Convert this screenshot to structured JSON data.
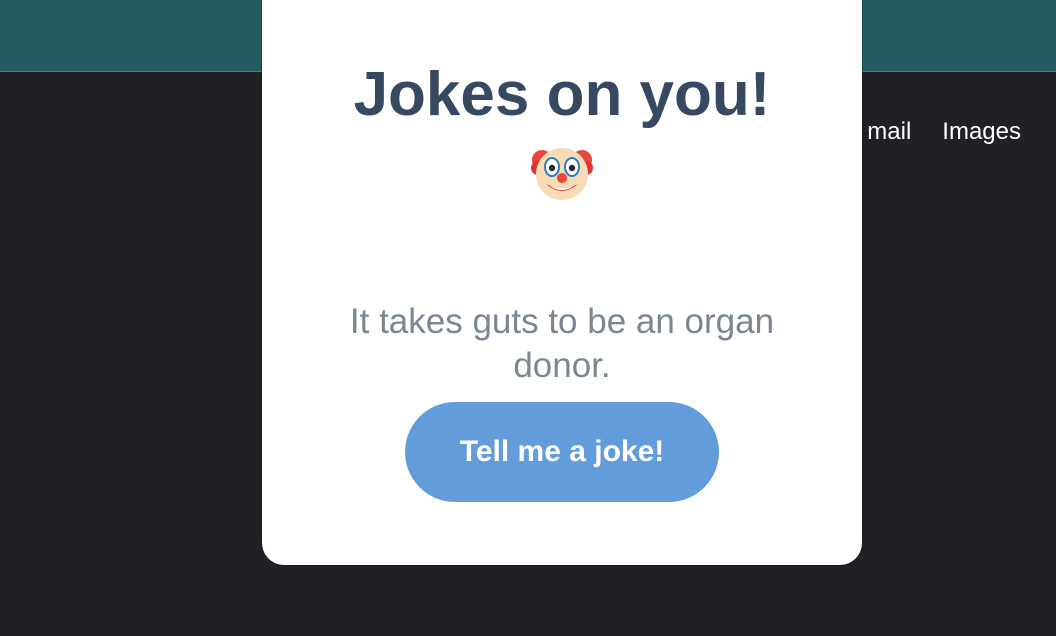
{
  "background_nav": {
    "items": [
      "mail",
      "Images"
    ]
  },
  "popup": {
    "title": "Jokes on you!",
    "icon": "clown-face-icon",
    "joke": "It takes guts to be an organ donor.",
    "button_label": "Tell me a joke!"
  },
  "colors": {
    "top_bar": "#245b63",
    "page_background": "#202124",
    "title": "#374961",
    "joke_text": "#7b8593",
    "button": "#629cdb"
  }
}
